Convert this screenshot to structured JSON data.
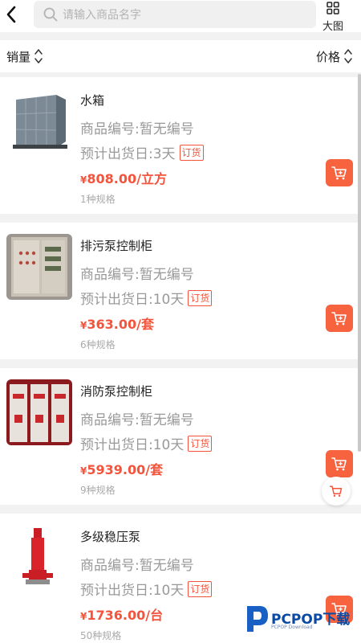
{
  "header": {
    "search_placeholder": "请输入商品名字",
    "bigview_label": "大图"
  },
  "sortbar": {
    "sales_label": "销量",
    "price_label": "价格"
  },
  "products": [
    {
      "title": "水箱",
      "code": "商品编号:暂无编号",
      "ship": "预计出货日:3天",
      "tag": "订货",
      "currency": "¥",
      "price": "808.00/立方",
      "specs": "1种规格"
    },
    {
      "title": "排污泵控制柜",
      "code": "商品编号:暂无编号",
      "ship": "预计出货日:10天",
      "tag": "订货",
      "currency": "¥",
      "price": "363.00/套",
      "specs": "6种规格"
    },
    {
      "title": "消防泵控制柜",
      "code": "商品编号:暂无编号",
      "ship": "预计出货日:10天",
      "tag": "订货",
      "currency": "¥",
      "price": "5939.00/套",
      "specs": "9种规格"
    },
    {
      "title": "多级稳压泵",
      "code": "商品编号:暂无编号",
      "ship": "预计出货日:10天",
      "tag": "订货",
      "currency": "¥",
      "price": "1736.00/台",
      "specs": "50种规格"
    }
  ],
  "watermark": {
    "text": "PCPOP下载",
    "sub": "PCPOP Download"
  },
  "colors": {
    "accent": "#f4543c",
    "cart": "#f7623f",
    "muted": "#999999"
  },
  "icons": {
    "back": "chevron-left-icon",
    "search": "search-icon",
    "bigview": "grid-icon",
    "sort": "sort-arrows-icon",
    "cart": "cart-icon"
  }
}
